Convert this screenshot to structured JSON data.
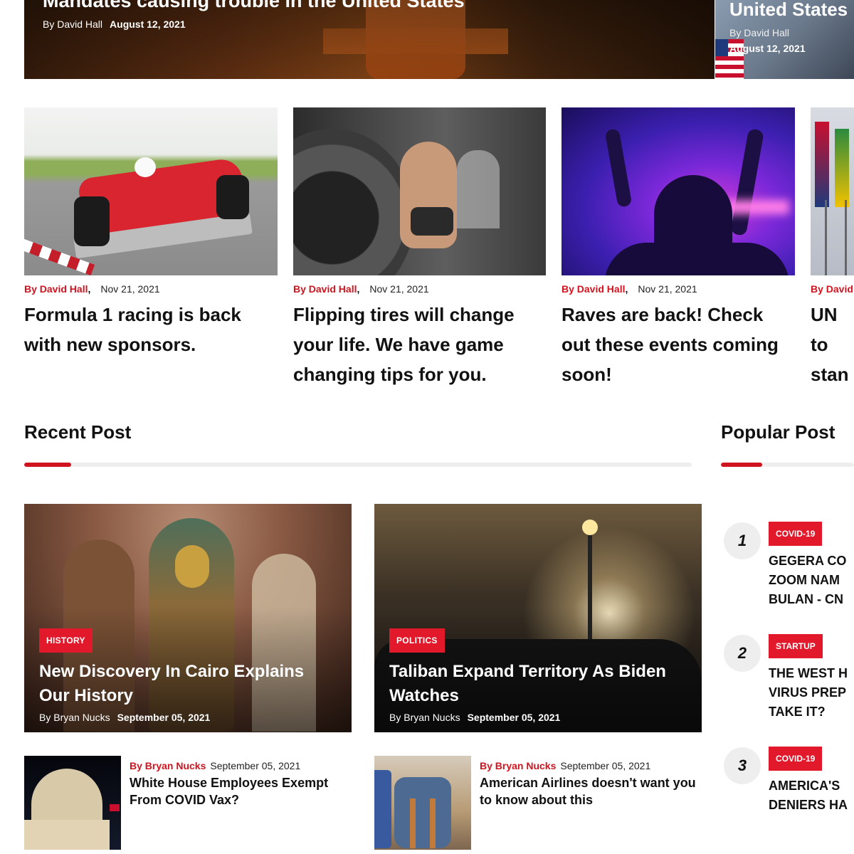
{
  "hero": {
    "main": {
      "title": "Mandates causing trouble in the United States",
      "author": "By David Hall",
      "date": "August 12, 2021"
    },
    "side": {
      "title": "United States",
      "author": "By David Hall",
      "date": "August 12, 2021"
    }
  },
  "cards": [
    {
      "author": "By David Hall",
      "date": "Nov 21, 2021",
      "title": "Formula 1 racing is back with new sponsors."
    },
    {
      "author": "By David Hall",
      "date": "Nov 21, 2021",
      "title": "Flipping tires will change your life. We have game changing tips for you."
    },
    {
      "author": "By David Hall",
      "date": "Nov 21, 2021",
      "title": "Raves are back! Check out these events coming soon!"
    },
    {
      "author": "By David",
      "title": "UN to stan"
    }
  ],
  "recent": {
    "heading": "Recent Post",
    "featured": [
      {
        "tag": "HISTORY",
        "title": "New Discovery In Cairo Explains Our History",
        "author": "By Bryan Nucks",
        "date": "September 05, 2021"
      },
      {
        "tag": "POLITICS",
        "title": "Taliban Expand Territory As Biden Watches",
        "author": "By Bryan Nucks",
        "date": "September 05, 2021"
      }
    ],
    "list": [
      {
        "author": "By Bryan Nucks",
        "date": "September 05, 2021",
        "title": "White House Employees Exempt From COVID Vax?"
      },
      {
        "author": "By Bryan Nucks",
        "date": "September 05, 2021",
        "title": "American Airlines doesn't want you to know about this"
      }
    ]
  },
  "popular": {
    "heading": "Popular Post",
    "items": [
      {
        "rank": "1",
        "tag": "COVID-19",
        "line1": "GEGERA CO",
        "line2": "ZOOM NAM",
        "line3": "BULAN - CN"
      },
      {
        "rank": "2",
        "tag": "STARTUP",
        "line1": "THE WEST H",
        "line2": "VIRUS PREP",
        "line3": "TAKE IT?"
      },
      {
        "rank": "3",
        "tag": "COVID-19",
        "line1": "AMERICA'S",
        "line2": "DENIERS HA"
      }
    ]
  },
  "colors": {
    "accent": "#d0141f",
    "tag": "#e2182b"
  }
}
